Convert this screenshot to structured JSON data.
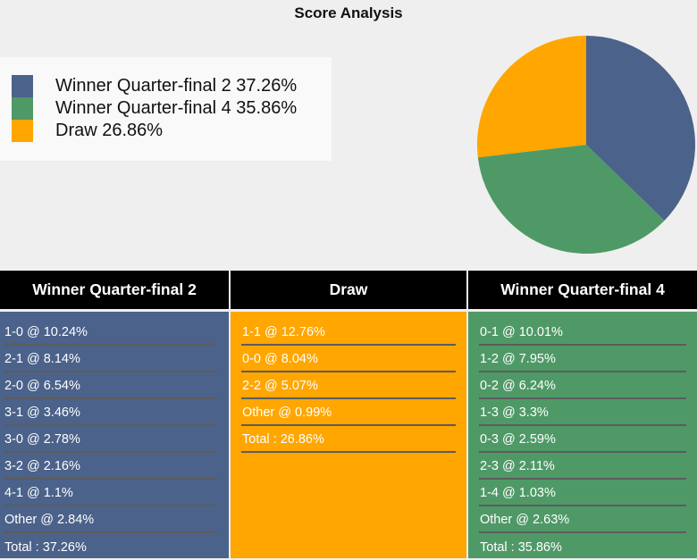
{
  "title": "Score Analysis",
  "colors": {
    "team1": "#4b628a",
    "team2": "#4f9967",
    "draw": "#ffa600",
    "header_bg": "#000000",
    "background": "#efefef"
  },
  "legend": [
    {
      "label": "Winner Quarter-final 2 37.26%",
      "color": "#4b628a"
    },
    {
      "label": "Winner Quarter-final 4 35.86%",
      "color": "#4f9967"
    },
    {
      "label": "Draw 26.86%",
      "color": "#ffa600"
    }
  ],
  "chart_data": {
    "type": "pie",
    "title": "Score Analysis",
    "legend_position": "left",
    "slices": [
      {
        "name": "Winner Quarter-final 2",
        "value": 37.26,
        "color": "#4b628a"
      },
      {
        "name": "Winner Quarter-final 4",
        "value": 35.86,
        "color": "#4f9967"
      },
      {
        "name": "Draw",
        "value": 26.86,
        "color": "#ffa600"
      }
    ]
  },
  "columns": [
    {
      "header": "Winner Quarter-final 2",
      "color": "#4b628a",
      "rows": [
        "1-0 @ 10.24%",
        "2-1 @ 8.14%",
        "2-0 @ 6.54%",
        "3-1 @ 3.46%",
        "3-0 @ 2.78%",
        "3-2 @ 2.16%",
        "4-1 @ 1.1%",
        "Other @ 2.84%",
        "Total : 37.26%"
      ]
    },
    {
      "header": "Draw",
      "color": "#ffa600",
      "rows": [
        "1-1 @ 12.76%",
        "0-0 @ 8.04%",
        "2-2 @ 5.07%",
        "Other @ 0.99%",
        "Total : 26.86%"
      ]
    },
    {
      "header": "Winner Quarter-final 4",
      "color": "#4f9967",
      "rows": [
        "0-1 @ 10.01%",
        "1-2 @ 7.95%",
        "0-2 @ 6.24%",
        "1-3 @ 3.3%",
        "0-3 @ 2.59%",
        "2-3 @ 2.11%",
        "1-4 @ 1.03%",
        "Other @ 2.63%",
        "Total : 35.86%"
      ]
    }
  ]
}
